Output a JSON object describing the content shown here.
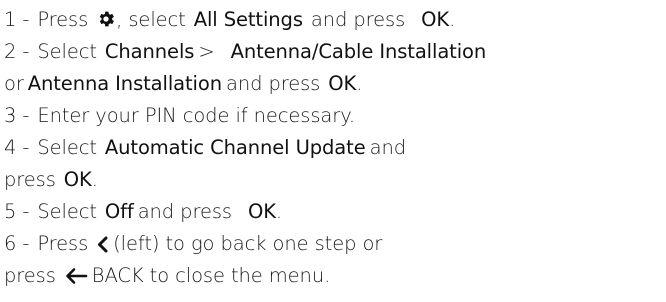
{
  "steps": [
    {
      "num": "1 -",
      "pre": "Press",
      "icon": "gear-icon",
      "mid": ", select",
      "kw1": "All Settings",
      "post": "and press",
      "kw2": "OK",
      "end": "."
    },
    {
      "num": "2 -",
      "pre": "Select",
      "kw1": "Channels",
      "sep": ">",
      "kw2": "Antenna/Cable Installation"
    },
    {
      "pre": "or",
      "kw1": "Antenna Installation",
      "post": "and press",
      "kw2": "OK",
      "end": "."
    },
    {
      "num": "3 -",
      "text": "Enter your PIN code if necessary."
    },
    {
      "num": "4 -",
      "pre": "Select",
      "kw1": "Automatic Channel Update",
      "post": "and"
    },
    {
      "pre": "press",
      "kw1": "OK",
      "end": "."
    },
    {
      "num": "5 -",
      "pre": "Select",
      "kw1": "Off",
      "post": "and press",
      "kw2": "OK",
      "end": "."
    },
    {
      "num": "6 -",
      "pre": "Press",
      "icon": "chevron-left-icon",
      "post": "(left) to go back one step or"
    },
    {
      "pre": "press",
      "icon": "arrow-left-icon",
      "post": "BACK to close the menu."
    }
  ]
}
